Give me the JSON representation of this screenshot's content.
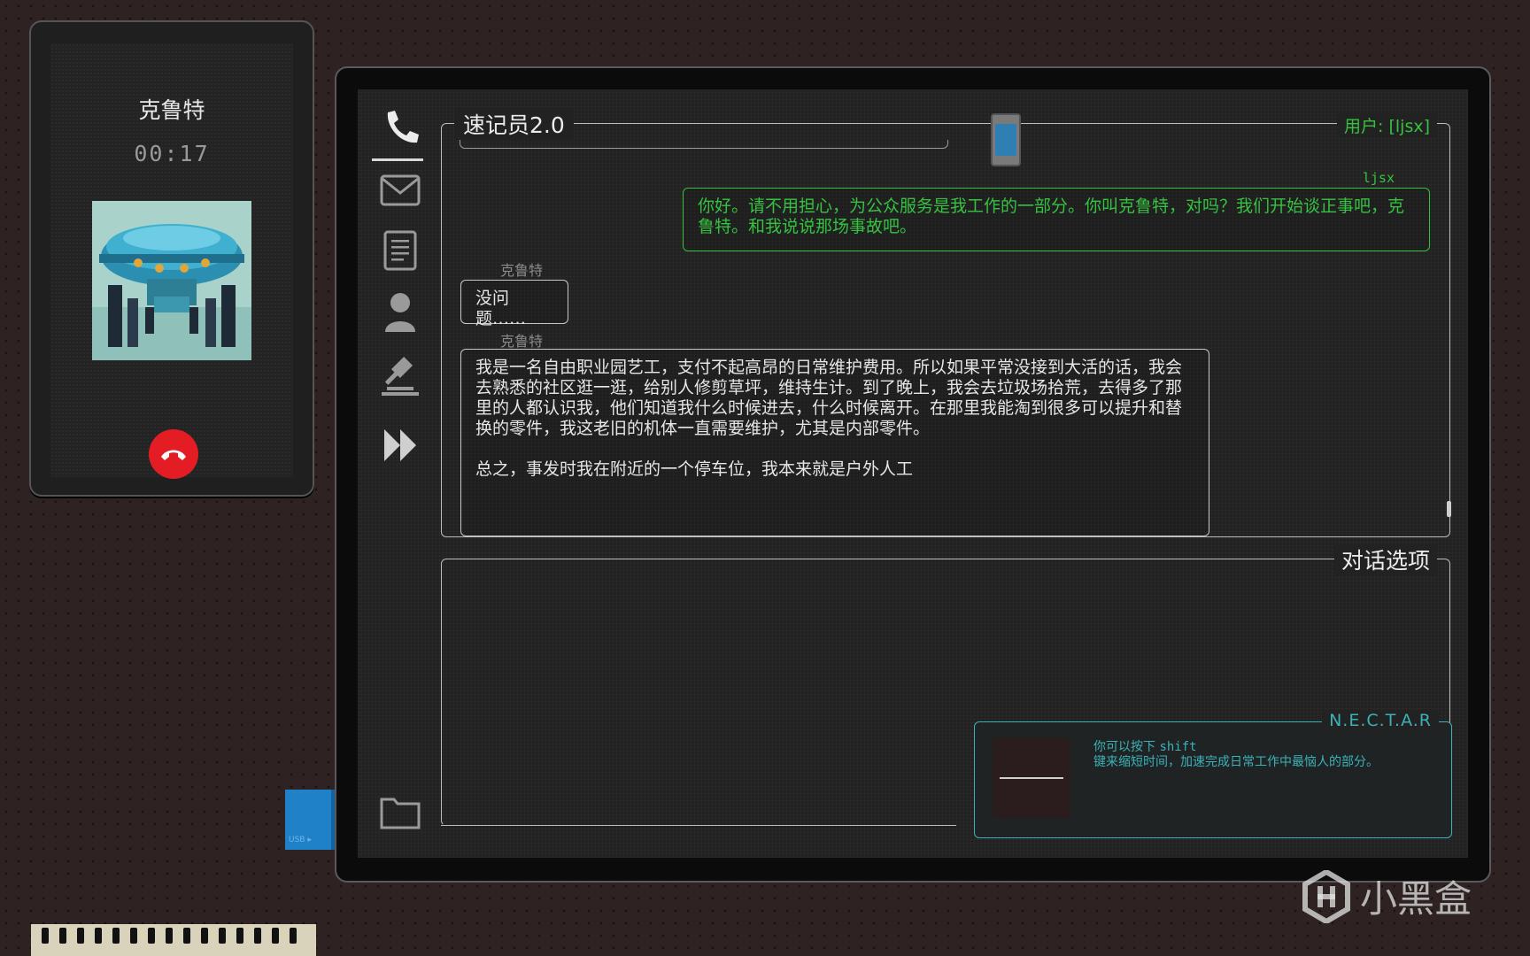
{
  "call": {
    "caller_name": "克鲁特",
    "timer": "00:17"
  },
  "app": {
    "title": "速记员2.0",
    "user_label": "用户: [ljsx]"
  },
  "nav": {
    "items": [
      "phone-icon",
      "mail-icon",
      "document-icon",
      "person-icon",
      "gavel-icon",
      "fast-forward-icon"
    ],
    "bottom": "folder-icon"
  },
  "transcript": {
    "messages": [
      {
        "speaker": "ljsx",
        "text": "你好。请不用担心，为公众服务是我工作的一部分。你叫克鲁特，对吗？我们开始谈正事吧，克鲁特。和我说说那场事故吧。"
      },
      {
        "speaker": "克鲁特",
        "text": "没问题……"
      },
      {
        "speaker": "克鲁特",
        "text": "我是一名自由职业园艺工，支付不起高昂的日常维护费用。所以如果平常没接到大活的话，我会去熟悉的社区逛一逛，给别人修剪草坪，维持生计。到了晚上，我会去垃圾场拾荒，去得多了那里的人都认识我，他们知道我什么时候进去，什么时候离开。在那里我能淘到很多可以提升和替换的零件，我这老旧的机体一直需要维护，尤其是内部零件。\n\n总之，事发时我在附近的一个停车位，我本来就是户外人工"
      }
    ]
  },
  "options": {
    "title": "对话选项"
  },
  "nectar": {
    "title": "N.E.C.T.A.R",
    "line1_prefix": "你可以按下 ",
    "line1_key": "shift",
    "line2": "键来缩短时间，加速完成日常工作中最恼人的部分。"
  },
  "usb": {
    "label": "USB ▸"
  },
  "watermark": {
    "text": "小黑盒"
  },
  "colors": {
    "user_green": "#35c240",
    "nectar_cyan": "#3bb2b8",
    "hangup_red": "#e41d24",
    "background": "#2e2223"
  }
}
